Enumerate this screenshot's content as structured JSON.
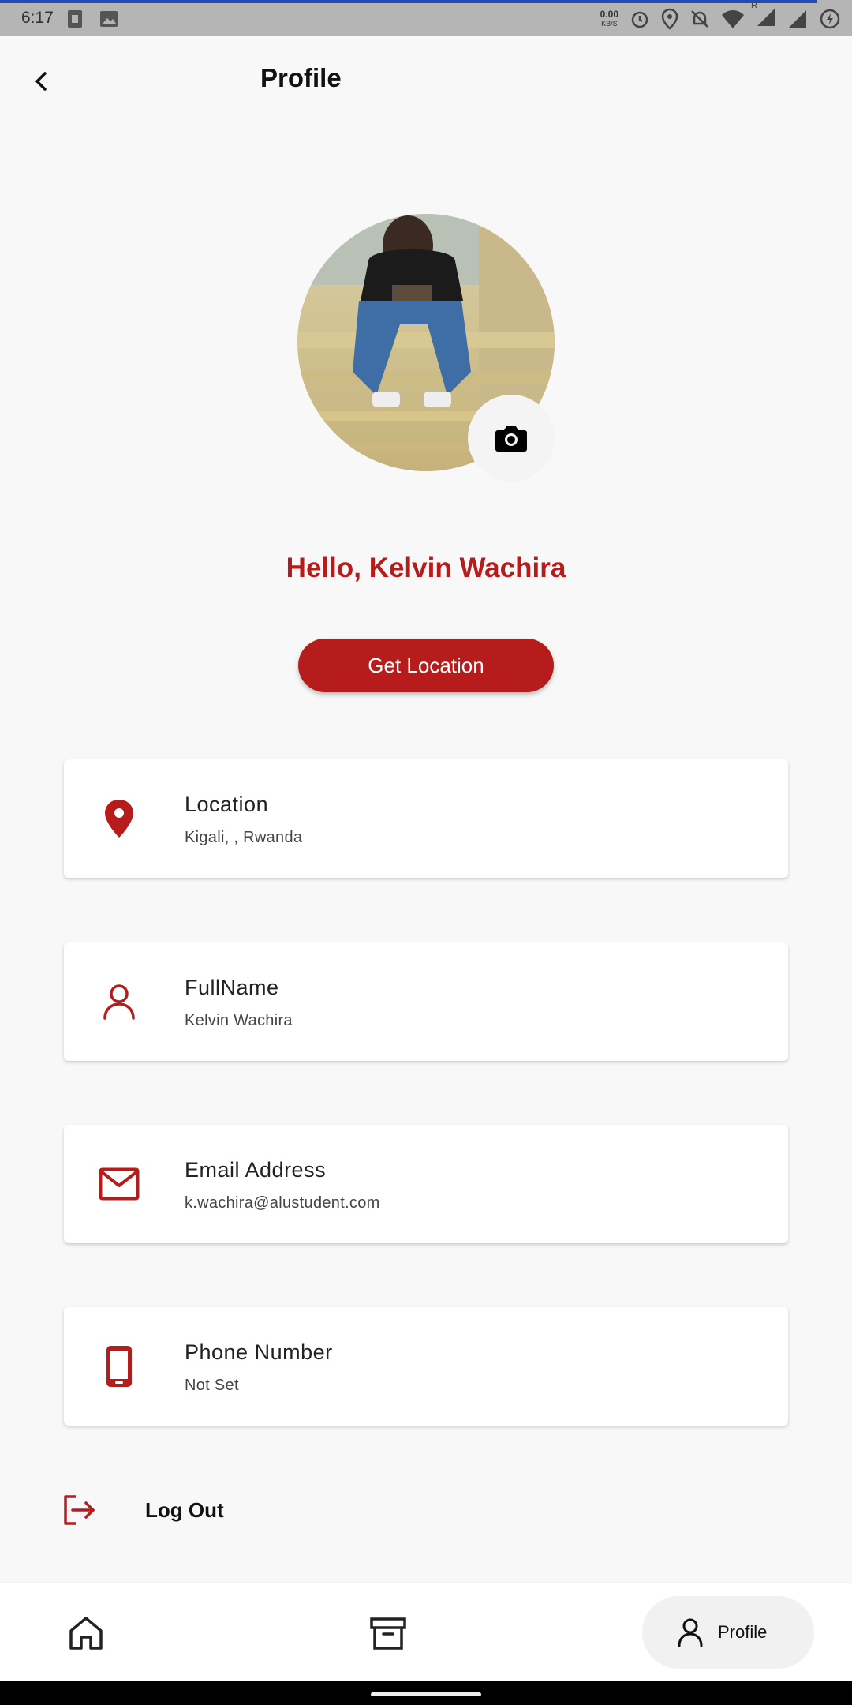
{
  "status_bar": {
    "time": "6:17",
    "net_speed": "0.00",
    "net_unit": "KB/S",
    "roaming": "R"
  },
  "header": {
    "title": "Profile"
  },
  "profile": {
    "greeting": "Hello, Kelvin Wachira",
    "get_location_label": "Get Location"
  },
  "cards": [
    {
      "title": "Location",
      "value": "Kigali, , Rwanda",
      "icon": "location-pin-icon"
    },
    {
      "title": "FullName",
      "value": "Kelvin Wachira",
      "icon": "person-icon"
    },
    {
      "title": "Email Address",
      "value": "k.wachira@alustudent.com",
      "icon": "mail-icon"
    },
    {
      "title": "Phone Number",
      "value": "Not Set",
      "icon": "phone-icon"
    }
  ],
  "logout": {
    "label": "Log Out"
  },
  "bottom_nav": {
    "profile_label": "Profile"
  },
  "colors": {
    "accent": "#b71c1c",
    "background": "#f8f8f8"
  }
}
